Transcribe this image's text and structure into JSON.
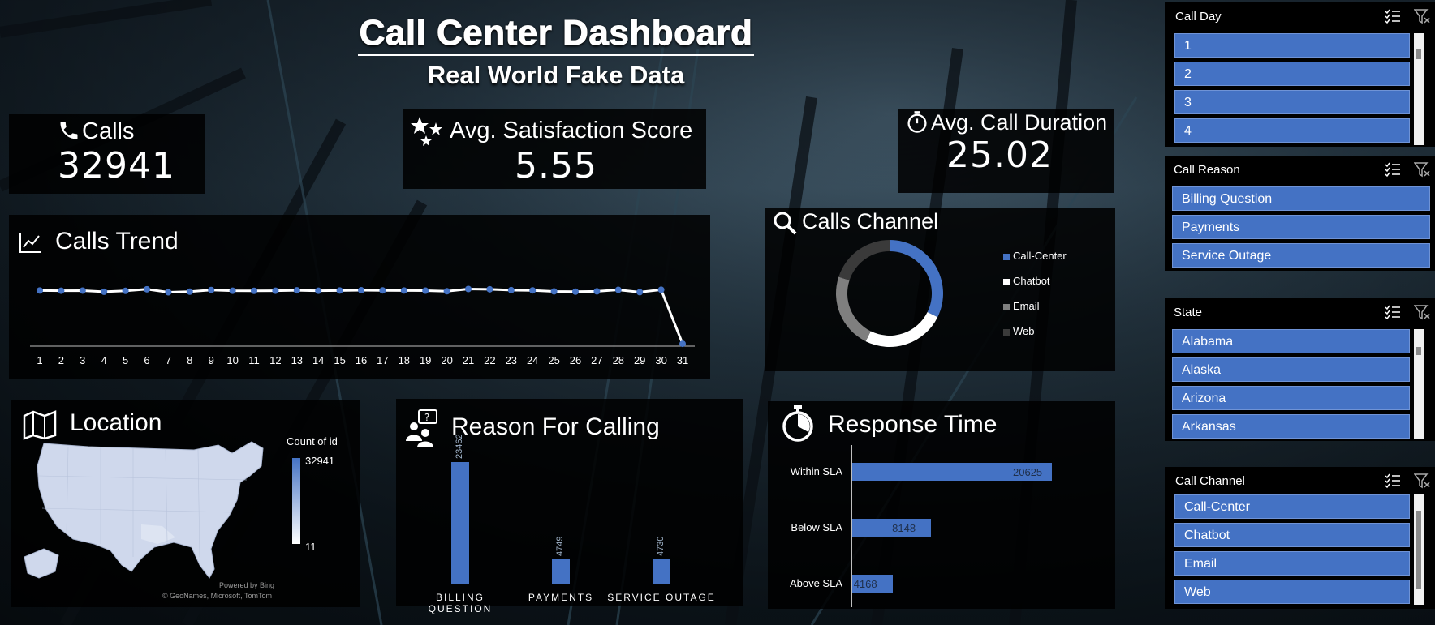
{
  "title": "Call Center Dashboard",
  "subtitle": "Real World Fake Data",
  "kpis": {
    "calls": {
      "label": "Calls",
      "value": "32941"
    },
    "satisfaction": {
      "label": "Avg. Satisfaction Score",
      "value": "5.55"
    },
    "duration": {
      "label": "Avg. Call Duration",
      "value": "25.02"
    }
  },
  "sections": {
    "trend": "Calls Trend",
    "channel": "Calls Channel",
    "location": "Location",
    "reason": "Reason For Calling",
    "response": "Response Time"
  },
  "location_map": {
    "legend_title": "Count of id",
    "legend_max": "32941",
    "legend_min": "11",
    "attribution_1": "Powered by Bing",
    "attribution_2": "© GeoNames, Microsoft, TomTom"
  },
  "slicers": {
    "call_day": {
      "title": "Call Day",
      "items": [
        "1",
        "2",
        "3",
        "4"
      ]
    },
    "call_reason": {
      "title": "Call Reason",
      "items": [
        "Billing Question",
        "Payments",
        "Service Outage"
      ]
    },
    "state": {
      "title": "State",
      "items": [
        "Alabama",
        "Alaska",
        "Arizona",
        "Arkansas"
      ]
    },
    "call_channel": {
      "title": "Call Channel",
      "items": [
        "Call-Center",
        "Chatbot",
        "Email",
        "Web"
      ]
    }
  },
  "colors": {
    "accent": "#4472c4",
    "chatbot": "#ffffff",
    "email": "#7f7f7f",
    "web": "#3a3a3a"
  },
  "chart_data": [
    {
      "type": "line",
      "title": "Calls Trend",
      "x": [
        1,
        2,
        3,
        4,
        5,
        6,
        7,
        8,
        9,
        10,
        11,
        12,
        13,
        14,
        15,
        16,
        17,
        18,
        19,
        20,
        21,
        22,
        23,
        24,
        25,
        26,
        27,
        28,
        29,
        30,
        31
      ],
      "values": [
        1085,
        1080,
        1083,
        1060,
        1078,
        1110,
        1050,
        1062,
        1095,
        1080,
        1078,
        1081,
        1088,
        1080,
        1085,
        1090,
        1087,
        1085,
        1082,
        1070,
        1115,
        1110,
        1092,
        1087,
        1067,
        1062,
        1068,
        1098,
        1052,
        1100,
        15
      ],
      "ylim": [
        0,
        1400
      ]
    },
    {
      "type": "pie",
      "title": "Calls Channel",
      "labels": [
        "Call-Center",
        "Chatbot",
        "Email",
        "Web"
      ],
      "values": [
        10639,
        8256,
        7470,
        6576
      ]
    },
    {
      "type": "bar",
      "title": "Reason For Calling",
      "categories": [
        "BILLING QUESTION",
        "PAYMENTS",
        "SERVICE OUTAGE"
      ],
      "values": [
        23462,
        4749,
        4730
      ]
    },
    {
      "type": "bar",
      "title": "Response Time",
      "orientation": "horizontal",
      "categories": [
        "Within SLA",
        "Below SLA",
        "Above SLA"
      ],
      "values": [
        20625,
        8148,
        4168
      ]
    }
  ]
}
